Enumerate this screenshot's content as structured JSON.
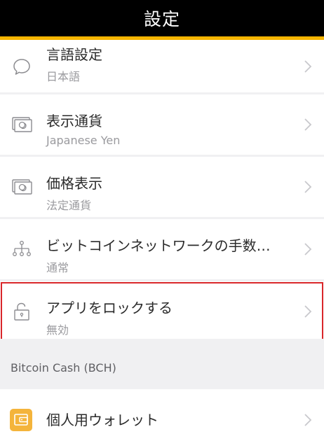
{
  "header": {
    "title": "設定"
  },
  "colors": {
    "header_bg": "#000000",
    "accent": "#f7b500",
    "highlight_border": "#d9262a",
    "wallet_icon": "#f4b43b"
  },
  "settings": [
    {
      "title": "言語設定",
      "value": "日本語",
      "icon": "chat-bubble-icon"
    },
    {
      "title": "表示通貨",
      "value": "Japanese Yen",
      "icon": "currency-note-icon"
    },
    {
      "title": "価格表示",
      "value": "法定通貨",
      "icon": "currency-note-icon"
    },
    {
      "title": "ビットコインネットワークの手数…",
      "value": "通常",
      "icon": "network-nodes-icon"
    },
    {
      "title": "アプリをロックする",
      "value": "無効",
      "icon": "unlocked-padlock-icon"
    }
  ],
  "section": {
    "title": "Bitcoin Cash (BCH)"
  },
  "wallet": {
    "title": "個人用ウォレット",
    "icon": "wallet-icon"
  }
}
